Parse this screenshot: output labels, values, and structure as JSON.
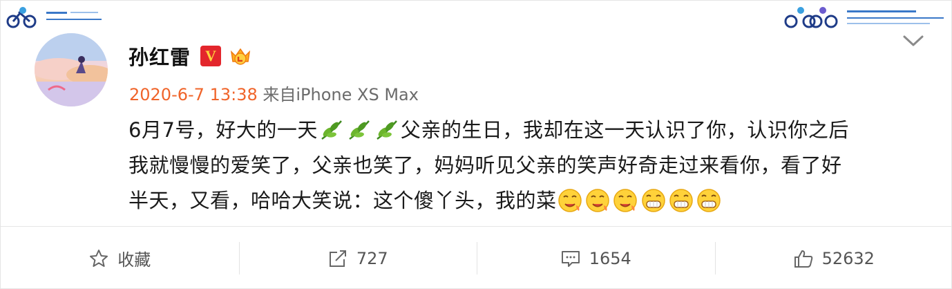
{
  "post": {
    "username": "孙红雷",
    "verified_badge": "V",
    "avatar_icon": "avatar-icon",
    "meta": {
      "time": "2020-6-7 13:38",
      "source_prefix": "来自",
      "device": "iPhone XS Max"
    },
    "content": {
      "line1_a": "6月7号，好大的一天",
      "line1_b": "父亲的生日，我却在这一天认识了你，认识你之后",
      "line2": "我就慢慢的爱笑了，父亲也笑了，妈妈听见父亲的笑声好奇走过来看你，看了好",
      "line3": "半天，又看，哈哈大笑说：这个傻丫头，我的菜",
      "emojis_line1": [
        "leaf-emoji",
        "leaf-emoji",
        "leaf-emoji"
      ],
      "emojis_line3": [
        "drool-emoji",
        "drool-emoji",
        "drool-emoji",
        "grin-emoji",
        "grin-emoji",
        "grin-emoji"
      ]
    }
  },
  "actions": {
    "favorite_label": "收藏",
    "repost_count": "727",
    "comment_count": "1654",
    "like_count": "52632"
  },
  "colors": {
    "time": "#f0642a",
    "verified": "#e3262c",
    "text": "#1a1a1a",
    "meta": "#6b6b6b"
  }
}
